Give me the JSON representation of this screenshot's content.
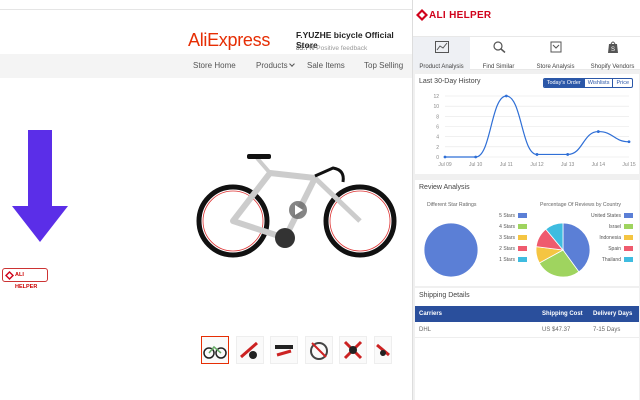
{
  "store": {
    "logo": "AliExpress",
    "name": "F.YUZHE bicycle Official Store",
    "feedback_value": "85.7%",
    "feedback_label": "Positive feedback",
    "nav": [
      "Store Home",
      "Products",
      "Sale Items",
      "Top Selling"
    ]
  },
  "badge": {
    "label": "ALI HELPER"
  },
  "panel": {
    "logo": "ALI HELPER",
    "tabs": [
      {
        "label": "Product Analysis",
        "icon": "chart-icon"
      },
      {
        "label": "Find Similar",
        "icon": "magnifier-icon"
      },
      {
        "label": "Store Analysis",
        "icon": "store-icon"
      },
      {
        "label": "Shopify Vendors",
        "icon": "shopify-bag-icon"
      }
    ],
    "history": {
      "title": "Last 30-Day History",
      "toggles": [
        "Today's Order",
        "Wishlists",
        "Price"
      ]
    },
    "review": {
      "title": "Review Analysis",
      "star_title": "Different Star Ratings",
      "country_title": "Percentage Of Reviews by Country",
      "star_legend": [
        "5 Stars",
        "4 Stars",
        "3 Stars",
        "2 Stars",
        "1 Stars"
      ],
      "country_legend": [
        "United States",
        "Israel",
        "Indonesia",
        "Spain",
        "Thailand"
      ]
    },
    "shipping": {
      "title": "Shipping Details",
      "headers": [
        "Carriers",
        "Shipping Cost",
        "Delivery Days"
      ],
      "rows": [
        [
          "DHL",
          "US $47.37",
          "7-15 Days"
        ]
      ]
    }
  },
  "colors": {
    "brand": "#e62e04",
    "arrow": "#5b2ee8",
    "header_blue": "#2a4f9c",
    "line": "#2f6fd6",
    "pie_blue": "#5b7fd6",
    "pie_green": "#9fd45f",
    "pie_yellow": "#f5c542",
    "pie_red": "#ef5b6e",
    "pie_cyan": "#3fbce0"
  },
  "chart_data": [
    {
      "type": "line",
      "title": "Last 30-Day History",
      "x": [
        "Jul 09",
        "Jul 10",
        "Jul 11",
        "Jul 12",
        "Jul 13",
        "Jul 14",
        "Jul 15"
      ],
      "series": [
        {
          "values": [
            0,
            0,
            12,
            0.5,
            0.5,
            5,
            3
          ]
        }
      ],
      "yticks": [
        0,
        2,
        4,
        6,
        8,
        10,
        12
      ],
      "ylim": [
        0,
        12
      ],
      "grid": true
    },
    {
      "type": "pie",
      "title": "Different Star Ratings",
      "labels": [
        "5 Stars",
        "4 Stars",
        "3 Stars",
        "2 Stars",
        "1 Stars"
      ],
      "values": [
        100,
        0,
        0,
        0,
        0
      ]
    },
    {
      "type": "pie",
      "title": "Percentage Of Reviews by Country",
      "labels": [
        "United States",
        "Israel",
        "Indonesia",
        "Spain",
        "Thailand"
      ],
      "values": [
        40,
        27,
        10,
        12,
        11
      ]
    }
  ]
}
